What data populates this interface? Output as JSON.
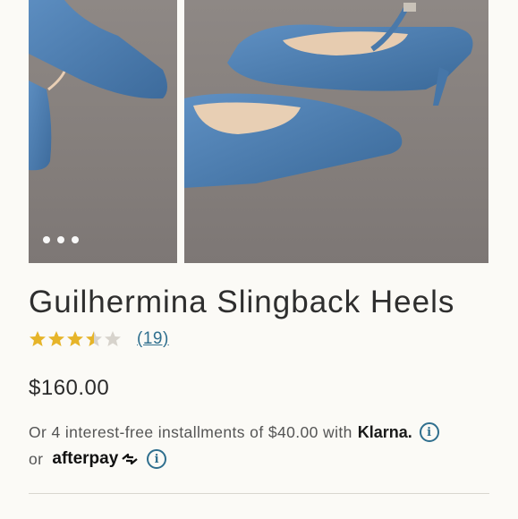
{
  "gallery": {
    "images": [
      {
        "alt_icon": "shoe-image-left"
      },
      {
        "alt_icon": "shoe-image-right"
      }
    ],
    "more_dots": 3
  },
  "product": {
    "title": "Guilhermina Slingback Heels",
    "rating": 3.5,
    "rating_max": 5,
    "review_count": "(19)",
    "price": "$160.00"
  },
  "payment": {
    "installments_text": "Or 4 interest-free installments of $40.00 with",
    "klarna_label": "Klarna.",
    "or_label": "or",
    "afterpay_label": "afterpay"
  },
  "colors": {
    "star_filled": "#e6b429",
    "star_empty": "#d7d3cc",
    "link": "#2f6f8e",
    "denim": "#4f7fae"
  }
}
